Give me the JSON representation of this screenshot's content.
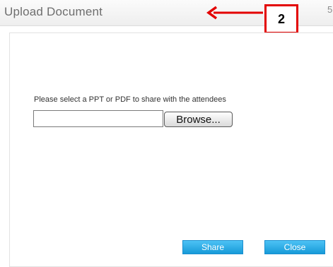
{
  "dialog": {
    "title": "Upload Document",
    "close_glyph": "5",
    "instruction": "Please select a PPT or PDF to share with the attendees",
    "file_input": {
      "value": "",
      "placeholder": ""
    },
    "browse_label": "Browse...",
    "share_label": "Share",
    "close_label": "Close"
  },
  "annotation": {
    "callout_number": "2",
    "arrow_icon": "left-arrow-icon",
    "color": "#e30000"
  },
  "colors": {
    "button_blue": "#169ad8",
    "title_text": "#6e6e6e"
  }
}
